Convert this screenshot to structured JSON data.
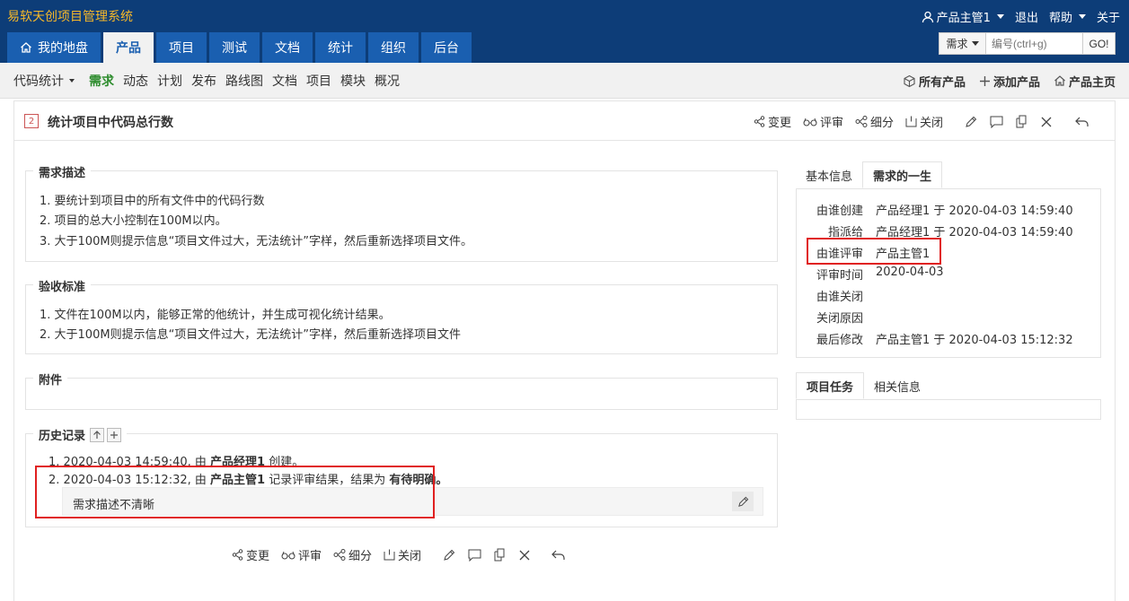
{
  "header": {
    "brand": "易软天创项目管理系统",
    "user": "产品主管1",
    "logout": "退出",
    "help": "帮助",
    "about": "关于"
  },
  "nav": {
    "tabs": [
      "我的地盘",
      "产品",
      "项目",
      "测试",
      "文档",
      "统计",
      "组织",
      "后台"
    ],
    "active": "产品"
  },
  "search": {
    "type": "需求",
    "placeholder": "编号(ctrl+g)",
    "go": "GO!"
  },
  "subnav": {
    "items": [
      "代码统计",
      "需求",
      "动态",
      "计划",
      "发布",
      "路线图",
      "文档",
      "项目",
      "模块",
      "概况"
    ],
    "active": "需求",
    "right": [
      "所有产品",
      "添加产品",
      "产品主页"
    ]
  },
  "story": {
    "id": "2",
    "title": "统计项目中代码总行数"
  },
  "actions": {
    "change": "变更",
    "review": "评审",
    "subdivide": "细分",
    "close": "关闭"
  },
  "description": {
    "title": "需求描述",
    "lines": [
      "1. 要统计到项目中的所有文件中的代码行数",
      "2. 项目的总大小控制在100M以内。",
      "3. 大于100M则提示信息“项目文件过大，无法统计”字样，然后重新选择项目文件。"
    ]
  },
  "verify": {
    "title": "验收标准",
    "lines": [
      "1. 文件在100M以内，能够正常的他统计，并生成可视化统计结果。",
      "2. 大于100M则提示信息“项目文件过大，无法统计”字样，然后重新选择项目文件"
    ]
  },
  "attachments": {
    "title": "附件"
  },
  "history": {
    "title": "历史记录",
    "entries": [
      {
        "num": "1.",
        "time": "2020-04-03 14:59:40, 由 ",
        "actor": "产品经理1",
        "action": " 创建。",
        "result": ""
      },
      {
        "num": "2.",
        "time": "2020-04-03 15:12:32, 由 ",
        "actor": "产品主管1",
        "action": " 记录评审结果，结果为 ",
        "result": "有待明确。"
      }
    ],
    "comment": "需求描述不清晰"
  },
  "side": {
    "tabs": [
      "基本信息",
      "需求的一生"
    ],
    "active_tab": "需求的一生",
    "life": [
      {
        "label": "由谁创建",
        "value": "产品经理1 于 2020-04-03 14:59:40"
      },
      {
        "label": "指派给",
        "value": "产品经理1 于 2020-04-03 14:59:40"
      },
      {
        "label": "由谁评审",
        "value": "产品主管1"
      },
      {
        "label": "评审时间",
        "value": "2020-04-03"
      },
      {
        "label": "由谁关闭",
        "value": ""
      },
      {
        "label": "关闭原因",
        "value": ""
      },
      {
        "label": "最后修改",
        "value": "产品主管1 于 2020-04-03 15:12:32"
      }
    ],
    "tabs2": [
      "项目任务",
      "相关信息"
    ],
    "active_tab2": "项目任务"
  },
  "colors": {
    "topbar": "#0d3d78",
    "brand": "#f6b829",
    "tab": "#1a5fb0",
    "active_subnav": "#2d8c2d",
    "highlight": "#e02020"
  }
}
